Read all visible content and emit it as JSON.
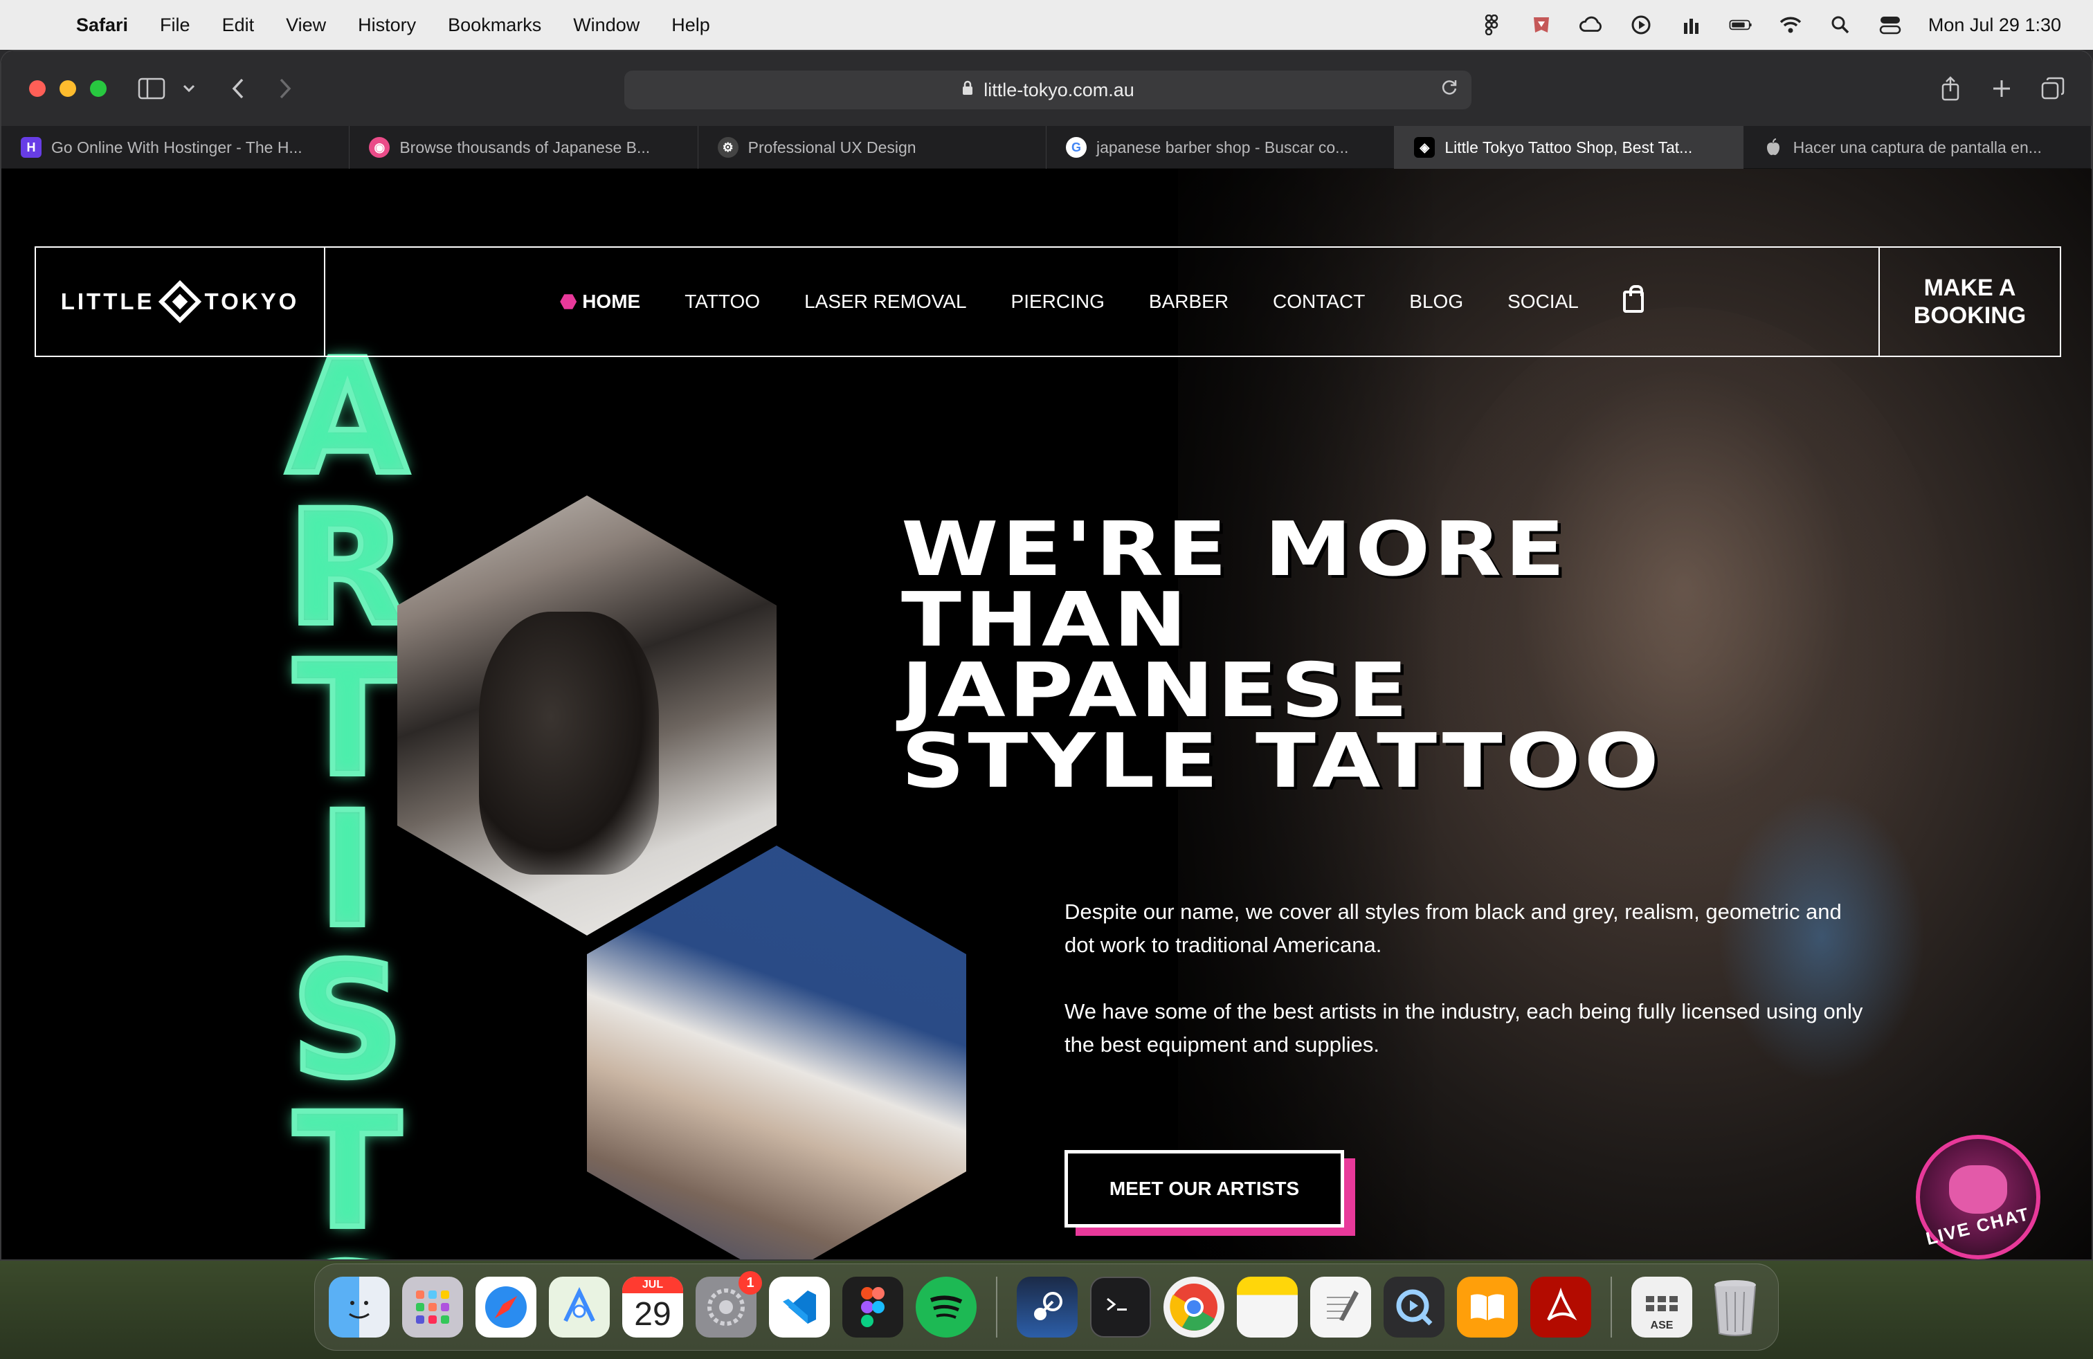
{
  "menubar": {
    "app_name": "Safari",
    "items": [
      "File",
      "Edit",
      "View",
      "History",
      "Bookmarks",
      "Window",
      "Help"
    ],
    "status_icons": [
      "figma-icon",
      "extension-icon",
      "creative-cloud-icon",
      "play-icon",
      "wand-icon",
      "battery-icon",
      "wifi-icon",
      "search-icon",
      "control-center-icon"
    ],
    "clock": "Mon Jul 29  1:30"
  },
  "browser": {
    "url": "little-tokyo.com.au",
    "tabs": [
      {
        "title": "Go Online With Hostinger - The H...",
        "favicon": "H",
        "color": "#673de6",
        "active": false
      },
      {
        "title": "Browse thousands of Japanese B...",
        "favicon": "◉",
        "color": "#ea4c89",
        "active": false
      },
      {
        "title": "Professional UX Design",
        "favicon": "⚙",
        "color": "#444444",
        "active": false
      },
      {
        "title": "japanese barber shop - Buscar co...",
        "favicon": "G",
        "color": "#ffffff",
        "active": false
      },
      {
        "title": "Little Tokyo Tattoo Shop, Best Tat...",
        "favicon": "◈",
        "color": "#000000",
        "active": true
      },
      {
        "title": "Hacer una captura de pantalla en...",
        "favicon": "",
        "color": "#555555",
        "active": false
      }
    ]
  },
  "site": {
    "logo_left": "LITTLE",
    "logo_right": "TOKYO",
    "nav": {
      "home": "HOME",
      "tattoo": "TATTOO",
      "laser": "LASER REMOVAL",
      "piercing": "PIERCING",
      "barber": "BARBER",
      "contact": "CONTACT",
      "blog": "BLOG",
      "social": "SOCIAL"
    },
    "booking_line1": "MAKE A",
    "booking_line2": "BOOKING",
    "neon_letters": [
      "A",
      "R",
      "T",
      "I",
      "S",
      "T",
      "S"
    ],
    "headline": [
      "WE'RE MORE",
      "THAN",
      "JAPANESE",
      "STYLE TATTOO"
    ],
    "paragraph1": "Despite our name, we cover all styles from black and grey, realism, geometric and dot work to traditional Americana.",
    "paragraph2": "We have some of the best artists in the industry, each being fully licensed using only the best equipment and supplies.",
    "cta": "MEET OUR ARTISTS",
    "live_chat": "LIVE CHAT",
    "accent_color": "#e8399a",
    "neon_color": "#6df2bb"
  },
  "dock": {
    "calendar_month": "JUL",
    "calendar_day": "29",
    "settings_badge": "1",
    "ase_label": "ASE"
  }
}
